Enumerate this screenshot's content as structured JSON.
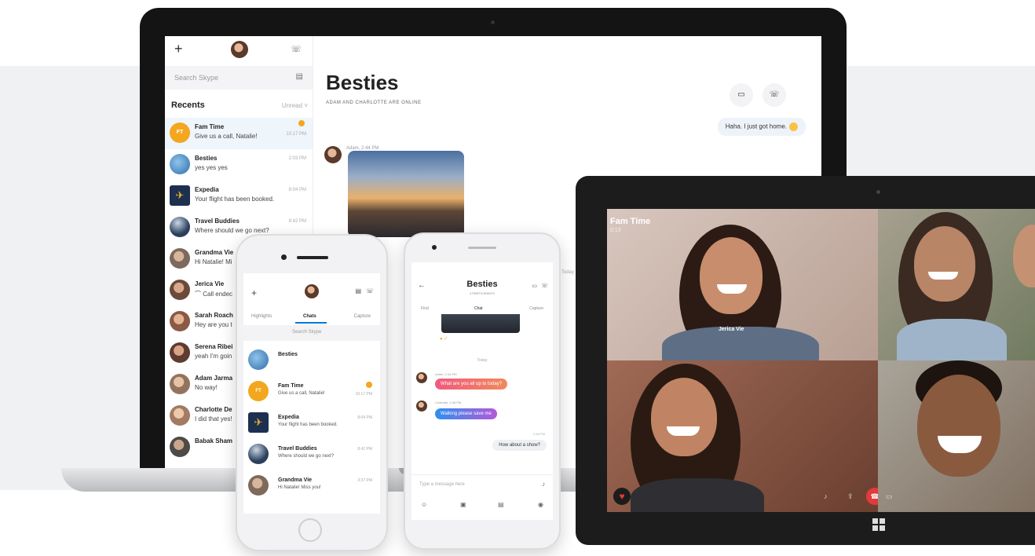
{
  "laptop": {
    "sidebar": {
      "search_placeholder": "Search Skype",
      "recents_label": "Recents",
      "filter_label": "Unread",
      "items": [
        {
          "name": "Fam Time",
          "message": "Give us a call, Natalie!",
          "time": "10:17 PM",
          "initials": "FT",
          "color": "#f3a71f"
        },
        {
          "name": "Besties",
          "message": "yes yes yes",
          "time": "2:03 PM",
          "color": "#3b8fd4"
        },
        {
          "name": "Expedia",
          "message": "Your flight has been booked.",
          "time": "8:04 PM",
          "color": "#1e3050"
        },
        {
          "name": "Travel Buddies",
          "message": "Where should we go next?",
          "time": "8:42 PM",
          "color": "#2b3f5c"
        },
        {
          "name": "Grandma Vie",
          "message": "Hi Natalie! Mi",
          "time": "",
          "color": "#7d6a5c"
        },
        {
          "name": "Jerica Vie",
          "message": "Call endec",
          "time": "",
          "color": "#6b4a3b"
        },
        {
          "name": "Sarah Roach",
          "message": "Hey are you t",
          "time": "",
          "color": "#8a5a44"
        },
        {
          "name": "Serena Ribei",
          "message": "yeah I'm goin",
          "time": "",
          "color": "#5e3c30"
        },
        {
          "name": "Adam Jarma",
          "message": "No way!",
          "time": "",
          "color": "#94735e"
        },
        {
          "name": "Charlotte De",
          "message": "I did that yes!",
          "time": "",
          "color": "#a27b62"
        },
        {
          "name": "Babak Sham",
          "message": "",
          "time": "",
          "color": "#4d4a48"
        }
      ]
    },
    "conversation": {
      "title": "Besties",
      "subtitle": "ADAM AND CHARLOTTE ARE ONLINE",
      "incoming_reply": "Haha. I just got home.",
      "sender_line": "Adam, 2:44 PM",
      "today_label": "Today"
    }
  },
  "phone_left": {
    "tabs": [
      "Highlights",
      "Chats",
      "Capture"
    ],
    "search_placeholder": "Search Skype",
    "items": [
      {
        "name": "Besties",
        "message": "",
        "time": "",
        "color": "#3b8fd4"
      },
      {
        "name": "Fam Time",
        "message": "Give us a call, Natalie!",
        "time": "10:17 PM",
        "initials": "FT",
        "color": "#f3a71f"
      },
      {
        "name": "Expedia",
        "message": "Your flight has been booked.",
        "time": "8:04 PM",
        "color": "#1e3050"
      },
      {
        "name": "Travel Buddies",
        "message": "Where should we go next?",
        "time": "8:42 PM",
        "color": "#2b3f5c"
      },
      {
        "name": "Grandma Vie",
        "message": "Hi Natalie! Miss you!",
        "time": "3:37 PM",
        "color": "#7d6a5c"
      }
    ]
  },
  "phone_right": {
    "title": "Besties",
    "subtitle": "4 PARTICIPANTS",
    "tabs": [
      "Find",
      "Chat",
      "Capture"
    ],
    "today_label": "Today",
    "msg1_sender": "Adam, 2:44 PM",
    "msg1": "What are you all up to today?",
    "msg2_sender": "Charlotte, 2:46 PM",
    "msg2": "Walking please save me",
    "reply_time": "2:48 PM",
    "reply": "How about a show?",
    "input_placeholder": "Type a message here"
  },
  "tablet": {
    "call_title": "Fam Time",
    "call_time": "0:13",
    "participant_label": "Jerica Vie"
  }
}
